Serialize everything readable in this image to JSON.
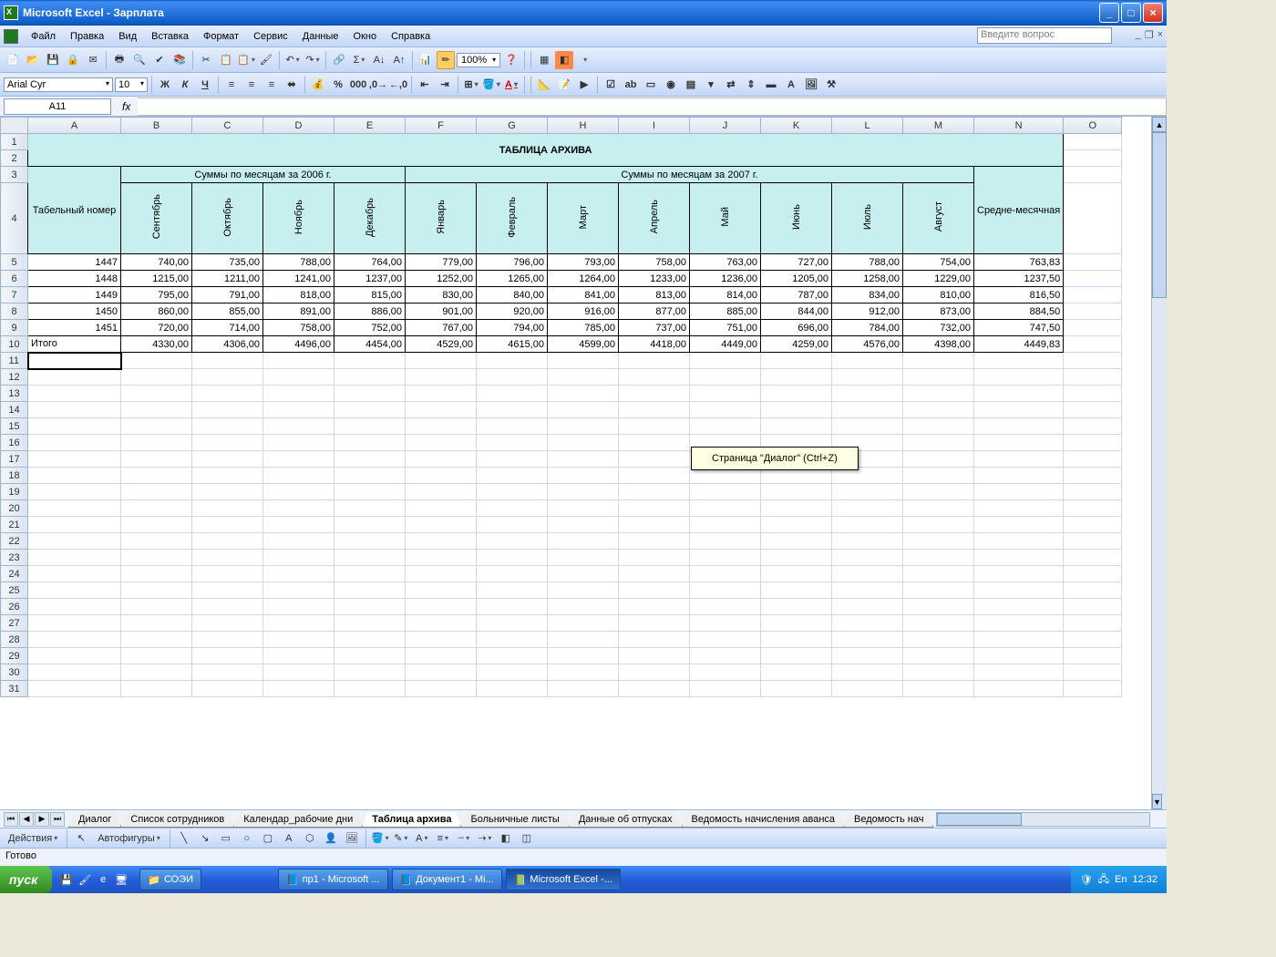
{
  "window": {
    "title": "Microsoft Excel - Зарплата"
  },
  "menu": {
    "file": "Файл",
    "edit": "Правка",
    "view": "Вид",
    "insert": "Вставка",
    "format": "Формат",
    "tools": "Сервис",
    "data": "Данные",
    "window": "Окно",
    "help": "Справка",
    "ask": "Введите вопрос"
  },
  "toolbar": {
    "zoom": "100%"
  },
  "format": {
    "font": "Arial Cyr",
    "size": "10"
  },
  "namebox": "A11",
  "table": {
    "title": "ТАБЛИЦА АРХИВА",
    "group2006": "Суммы по месяцам за 2006 г.",
    "group2007": "Суммы по месяцам за 2007 г.",
    "col_tab": "Табельный номер",
    "col_avg": "Средне-месячная",
    "months": [
      "Сентябрь",
      "Октябрь",
      "Ноябрь",
      "Декабрь",
      "Январь",
      "Февраль",
      "Март",
      "Апрель",
      "Май",
      "Июнь",
      "Июль",
      "Август"
    ],
    "rows": [
      {
        "id": "1447",
        "v": [
          "740,00",
          "735,00",
          "788,00",
          "764,00",
          "779,00",
          "796,00",
          "793,00",
          "758,00",
          "763,00",
          "727,00",
          "788,00",
          "754,00"
        ],
        "avg": "763,83"
      },
      {
        "id": "1448",
        "v": [
          "1215,00",
          "1211,00",
          "1241,00",
          "1237,00",
          "1252,00",
          "1265,00",
          "1264,00",
          "1233,00",
          "1236,00",
          "1205,00",
          "1258,00",
          "1229,00"
        ],
        "avg": "1237,50"
      },
      {
        "id": "1449",
        "v": [
          "795,00",
          "791,00",
          "818,00",
          "815,00",
          "830,00",
          "840,00",
          "841,00",
          "813,00",
          "814,00",
          "787,00",
          "834,00",
          "810,00"
        ],
        "avg": "816,50"
      },
      {
        "id": "1450",
        "v": [
          "860,00",
          "855,00",
          "891,00",
          "886,00",
          "901,00",
          "920,00",
          "916,00",
          "877,00",
          "885,00",
          "844,00",
          "912,00",
          "873,00"
        ],
        "avg": "884,50"
      },
      {
        "id": "1451",
        "v": [
          "720,00",
          "714,00",
          "758,00",
          "752,00",
          "767,00",
          "794,00",
          "785,00",
          "737,00",
          "751,00",
          "696,00",
          "784,00",
          "732,00"
        ],
        "avg": "747,50"
      }
    ],
    "total_label": "Итого",
    "totals": [
      "4330,00",
      "4306,00",
      "4496,00",
      "4454,00",
      "4529,00",
      "4615,00",
      "4599,00",
      "4418,00",
      "4449,00",
      "4259,00",
      "4576,00",
      "4398,00"
    ],
    "total_avg": "4449,83"
  },
  "tooltip": "Страница \"Диалог\" (Ctrl+Z)",
  "sheets": {
    "tabs": [
      "Диалог",
      "Список сотрудников",
      "Календар_рабочие дни",
      "Таблица архива",
      "Больничные листы",
      "Данные об отпусках",
      "Ведомость начисления аванса",
      "Ведомость нач"
    ],
    "active": 3
  },
  "drawbar": {
    "actions": "Действия",
    "autoshapes": "Автофигуры"
  },
  "status": "Готово",
  "taskbar": {
    "start": "пуск",
    "items": [
      "СОЭИ",
      "пр1 - Microsoft ...",
      "Документ1 - Mi...",
      "Microsoft Excel -..."
    ],
    "lang": "En",
    "time": "12:32"
  },
  "cols": [
    "A",
    "B",
    "C",
    "D",
    "E",
    "F",
    "G",
    "H",
    "I",
    "J",
    "K",
    "L",
    "M",
    "N",
    "O"
  ]
}
